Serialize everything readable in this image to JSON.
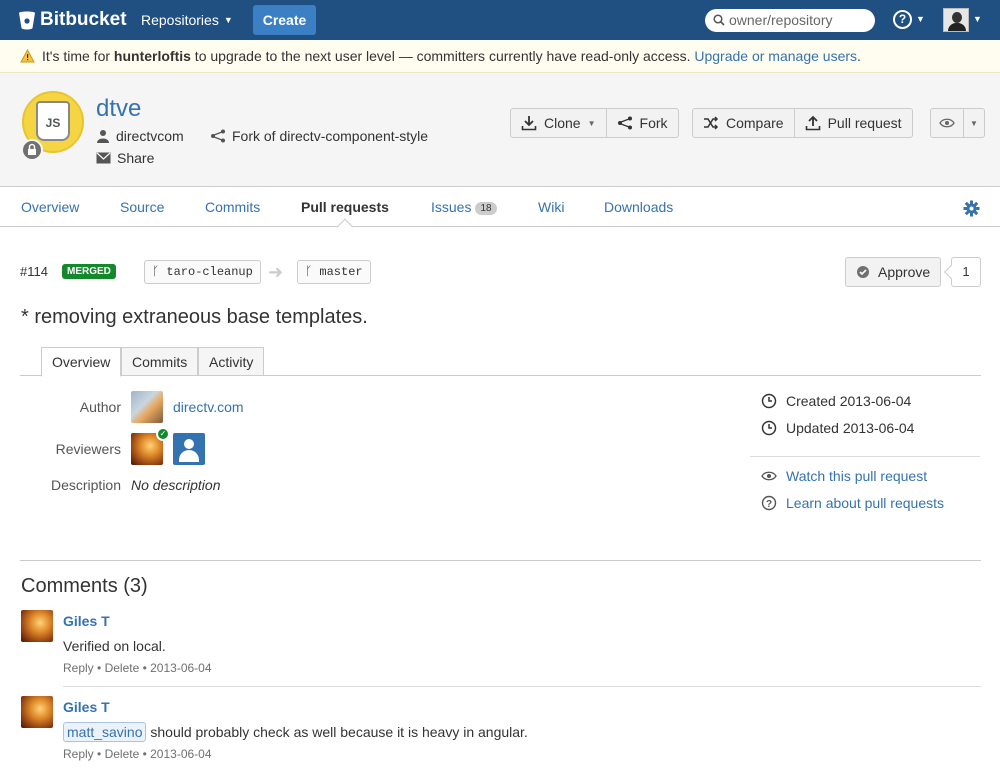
{
  "topbar": {
    "brand": "Bitbucket",
    "repositories_label": "Repositories",
    "create_label": "Create",
    "search_placeholder": "owner/repository",
    "help_label": "?"
  },
  "notice": {
    "text_before": "It's time for ",
    "username": "hunterloftis",
    "text_after": " to upgrade to the next user level — committers currently have read-only access. ",
    "link": "Upgrade or manage users",
    "period": "."
  },
  "repo": {
    "avatar_text": "JS",
    "name": "dtve",
    "owner": "directvcom",
    "share": "Share",
    "fork_of": "Fork of directv-component-style"
  },
  "actions": {
    "clone": "Clone",
    "fork": "Fork",
    "compare": "Compare",
    "pull_request": "Pull request"
  },
  "tabs": {
    "overview": "Overview",
    "source": "Source",
    "commits": "Commits",
    "pull_requests": "Pull requests",
    "issues": "Issues",
    "issues_count": "18",
    "wiki": "Wiki",
    "downloads": "Downloads"
  },
  "pr": {
    "id": "#114",
    "status": "MERGED",
    "source_branch": "taro-cleanup",
    "target_branch": "master",
    "approve_label": "Approve",
    "approve_count": "1",
    "title": "* removing extraneous base templates.",
    "subtabs": {
      "overview": "Overview",
      "commits": "Commits",
      "activity": "Activity"
    },
    "author_label": "Author",
    "author": "directv.com",
    "reviewers_label": "Reviewers",
    "description_label": "Description",
    "description": "No description",
    "created": "Created 2013-06-04",
    "updated": "Updated 2013-06-04",
    "watch": "Watch this pull request",
    "learn": "Learn about pull requests"
  },
  "comments": {
    "heading": "Comments (3)",
    "items": [
      {
        "author": "Giles T",
        "text": "Verified on local.",
        "reply": "Reply",
        "delete": "Delete",
        "date": "2013-06-04"
      },
      {
        "author": "Giles T",
        "mention": "matt_savino",
        "text": " should probably check as well because it is heavy in angular.",
        "reply": "Reply",
        "delete": "Delete",
        "date": "2013-06-04"
      }
    ]
  },
  "colors": {
    "brand": "#205081",
    "link": "#3572b0",
    "merged": "#14892c"
  }
}
